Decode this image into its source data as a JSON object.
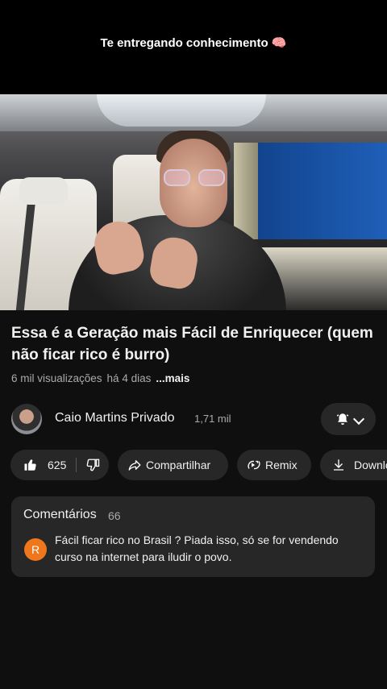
{
  "overlay": {
    "caption": "Te entregando conhecimento 🧠"
  },
  "video": {
    "title": "Essa é a Geração mais Fácil de Enriquecer (quem não ficar rico é burro)",
    "views": "6 mil visualizações",
    "age": "há 4 dias",
    "more_label": "...mais"
  },
  "channel": {
    "name": "Caio Martins Privado",
    "subscribers": "1,71 mil",
    "bell_icon": "bell-icon"
  },
  "actions": {
    "like_count": "625",
    "share_label": "Compartilhar",
    "remix_label": "Remix",
    "download_label": "Download"
  },
  "comments": {
    "heading": "Comentários",
    "count": "66",
    "top_comment": {
      "avatar_letter": "R",
      "avatar_color": "#f0761b",
      "text": "Fácil ficar rico no Brasil ? Piada isso,  só se for vendendo curso na internet para iludir o povo."
    }
  }
}
